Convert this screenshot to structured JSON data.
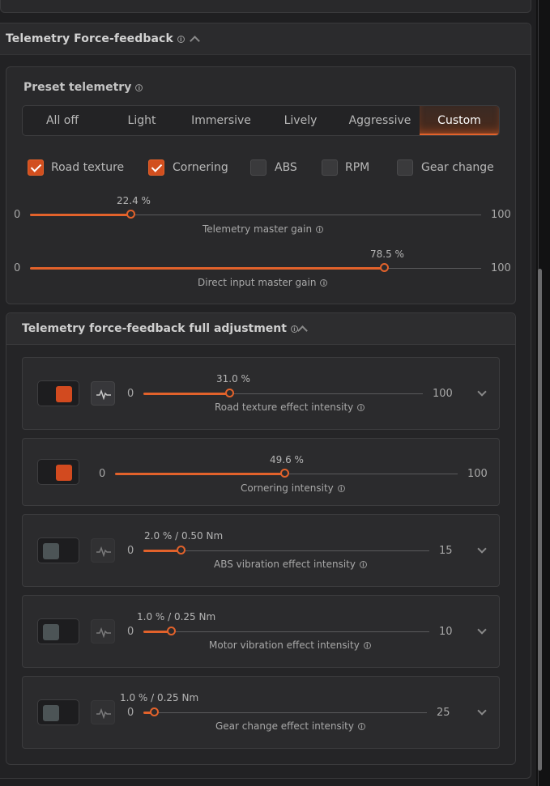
{
  "section": {
    "title": "Telemetry Force-feedback"
  },
  "preset": {
    "title": "Preset telemetry",
    "tabs": [
      "All off",
      "Light",
      "Immersive",
      "Lively",
      "Aggressive",
      "Custom"
    ],
    "active_tab": "Custom"
  },
  "effects": [
    {
      "label": "Road texture",
      "checked": true
    },
    {
      "label": "Cornering",
      "checked": true
    },
    {
      "label": "ABS",
      "checked": false
    },
    {
      "label": "RPM",
      "checked": false
    },
    {
      "label": "Gear change",
      "checked": false
    }
  ],
  "master_sliders": [
    {
      "label": "Telemetry master gain",
      "value_text": "22.4 %",
      "value": 22.4,
      "min": "0",
      "max": "100"
    },
    {
      "label": "Direct input master gain",
      "value_text": "78.5 %",
      "value": 78.5,
      "min": "0",
      "max": "100"
    }
  ],
  "adjustment": {
    "title": "Telemetry force-feedback full adjustment",
    "rows": [
      {
        "label": "Road texture effect intensity",
        "value_text": "31.0 %",
        "fraction": 0.31,
        "min": "0",
        "max": "100",
        "enabled": true
      },
      {
        "label": "Cornering intensity",
        "value_text": "49.6 %",
        "fraction": 0.496,
        "min": "0",
        "max": "100",
        "enabled": true
      },
      {
        "label": "ABS vibration effect intensity",
        "value_text": "2.0 % / 0.50 Nm",
        "fraction": 0.133,
        "min": "0",
        "max": "15",
        "enabled": false
      },
      {
        "label": "Motor vibration effect intensity",
        "value_text": "1.0 % / 0.25 Nm",
        "fraction": 0.1,
        "min": "0",
        "max": "10",
        "enabled": false
      },
      {
        "label": "Gear change effect intensity",
        "value_text": "1.0 % / 0.25 Nm",
        "fraction": 0.04,
        "min": "0",
        "max": "25",
        "enabled": false
      }
    ]
  },
  "colors": {
    "accent": "#e2622b",
    "panel": "#29292b",
    "background": "#1f1f21"
  }
}
